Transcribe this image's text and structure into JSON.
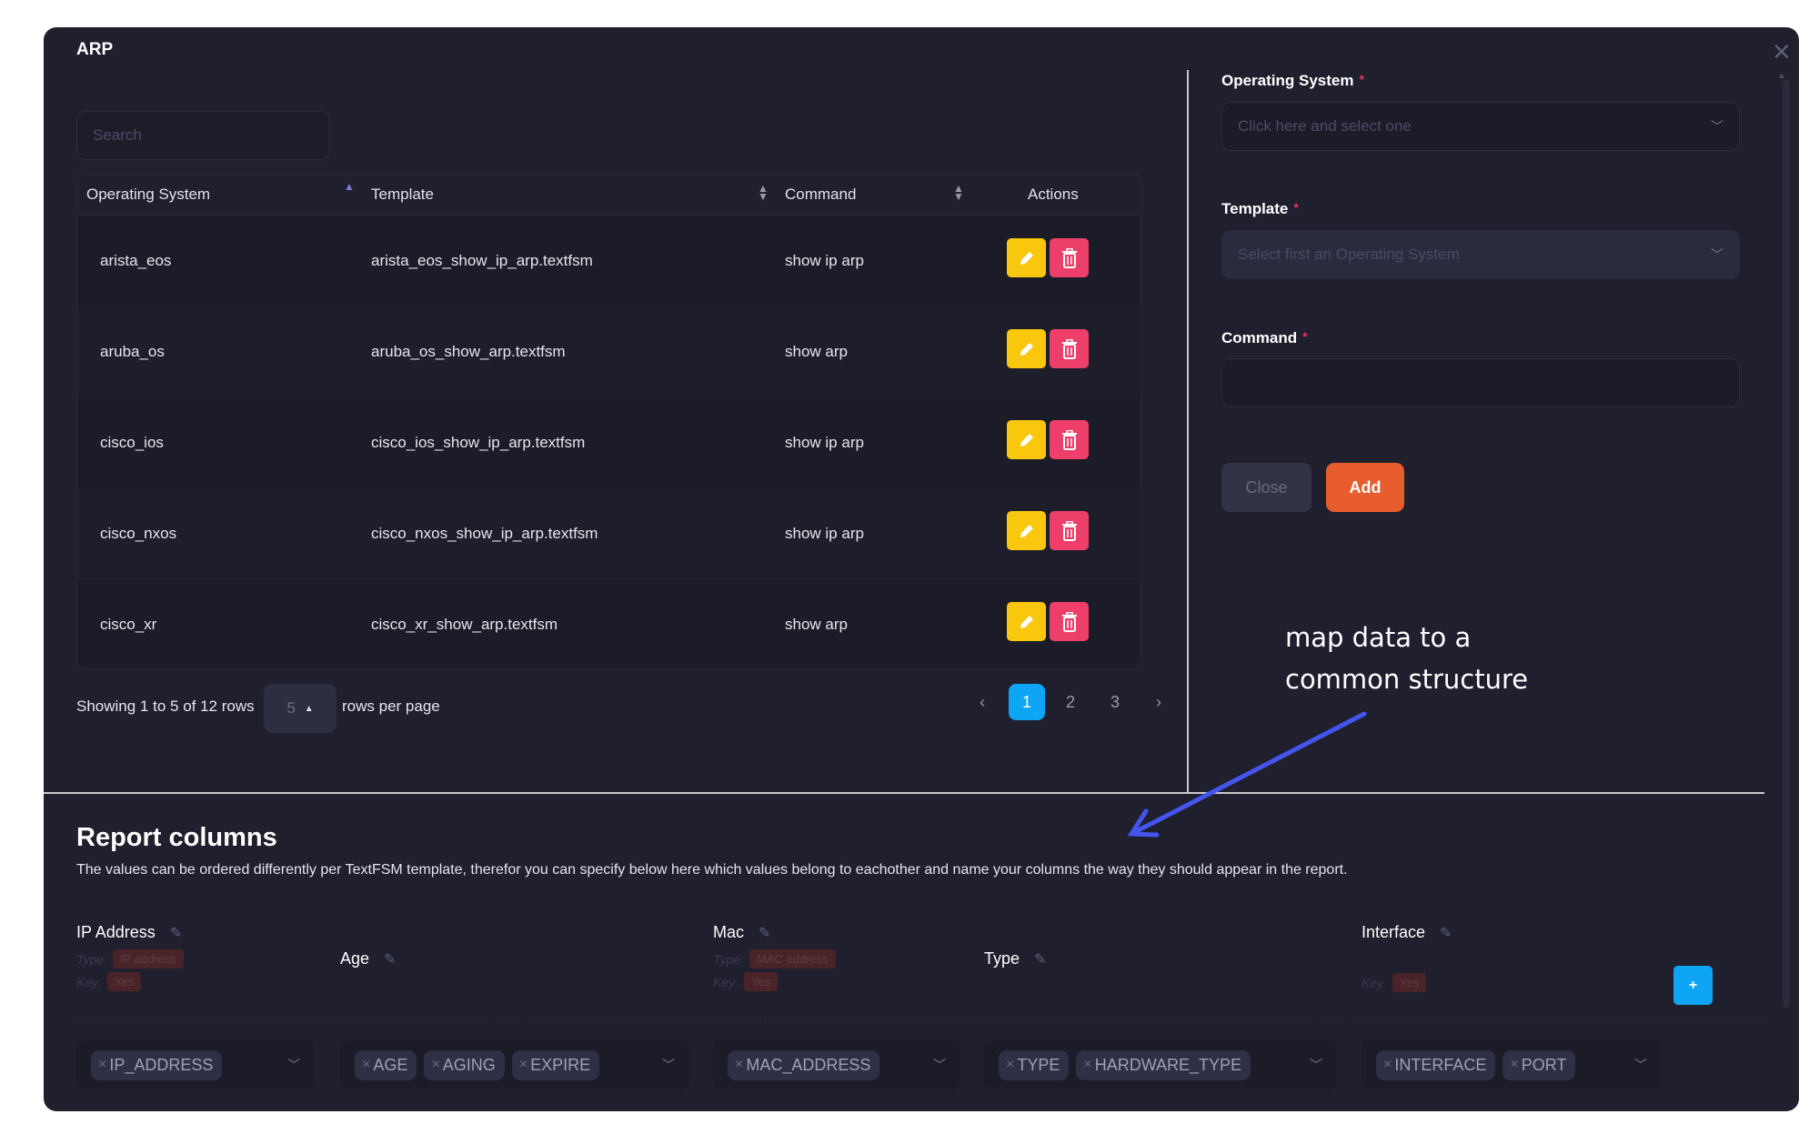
{
  "modal": {
    "title": "ARP",
    "close_icon": "close-icon"
  },
  "table": {
    "search_placeholder": "Search",
    "columns": [
      "Operating System",
      "Template",
      "Command",
      "Actions"
    ],
    "sort": {
      "os": "ascending",
      "template": "unsorted",
      "command": "unsorted"
    },
    "rows": [
      {
        "os": "arista_eos",
        "template": "arista_eos_show_ip_arp.textfsm",
        "command": "show ip arp"
      },
      {
        "os": "aruba_os",
        "template": "aruba_os_show_arp.textfsm",
        "command": "show arp"
      },
      {
        "os": "cisco_ios",
        "template": "cisco_ios_show_ip_arp.textfsm",
        "command": "show ip arp"
      },
      {
        "os": "cisco_nxos",
        "template": "cisco_nxos_show_ip_arp.textfsm",
        "command": "show ip arp"
      },
      {
        "os": "cisco_xr",
        "template": "cisco_xr_show_arp.textfsm",
        "command": "show arp"
      }
    ],
    "action_icons": [
      "pencil-icon",
      "trash-icon"
    ]
  },
  "pagination": {
    "info": "Showing 1 to 5 of 12 rows",
    "rows_per_page": "5",
    "rows_per_page_label": "rows per page",
    "prev": "‹",
    "next": "›",
    "pages": [
      "1",
      "2",
      "3"
    ],
    "current_page": "1"
  },
  "form": {
    "os_label": "Operating System",
    "os_placeholder": "Click here and select one",
    "template_label": "Template",
    "template_placeholder": "Select first an Operating System",
    "command_label": "Command",
    "command_value": "",
    "required_mark": "*",
    "close_label": "Close",
    "add_label": "Add"
  },
  "annotation": {
    "line1": "map data to a",
    "line2": "common structure",
    "arrow_color": "#4455ee"
  },
  "report": {
    "title": "Report columns",
    "description": "The values can be ordered differently per TextFSM template, therefor you can specify below here which values belong to eachother and name your columns the way they should appear in the report.",
    "type_label": "Type:",
    "key_label": "Key:",
    "add_button": "+",
    "columns": [
      {
        "name": "IP Address",
        "type": "IP address",
        "key": "Yes",
        "tags": [
          "IP_ADDRESS"
        ]
      },
      {
        "name": "Age",
        "tags": [
          "AGE",
          "AGING",
          "EXPIRE"
        ]
      },
      {
        "name": "Mac",
        "type": "MAC address",
        "key": "Yes",
        "tags": [
          "MAC_ADDRESS"
        ]
      },
      {
        "name": "Type",
        "tags": [
          "TYPE",
          "HARDWARE_TYPE"
        ]
      },
      {
        "name": "Interface",
        "key": "Yes",
        "tags": [
          "INTERFACE",
          "PORT"
        ]
      }
    ]
  },
  "colors": {
    "panel_bg": "#1f1f2d",
    "edit": "#f9c80e",
    "delete": "#ee3f6b",
    "primary": "#0ea5f5",
    "add": "#e85d2d",
    "required": "#e8345c"
  }
}
